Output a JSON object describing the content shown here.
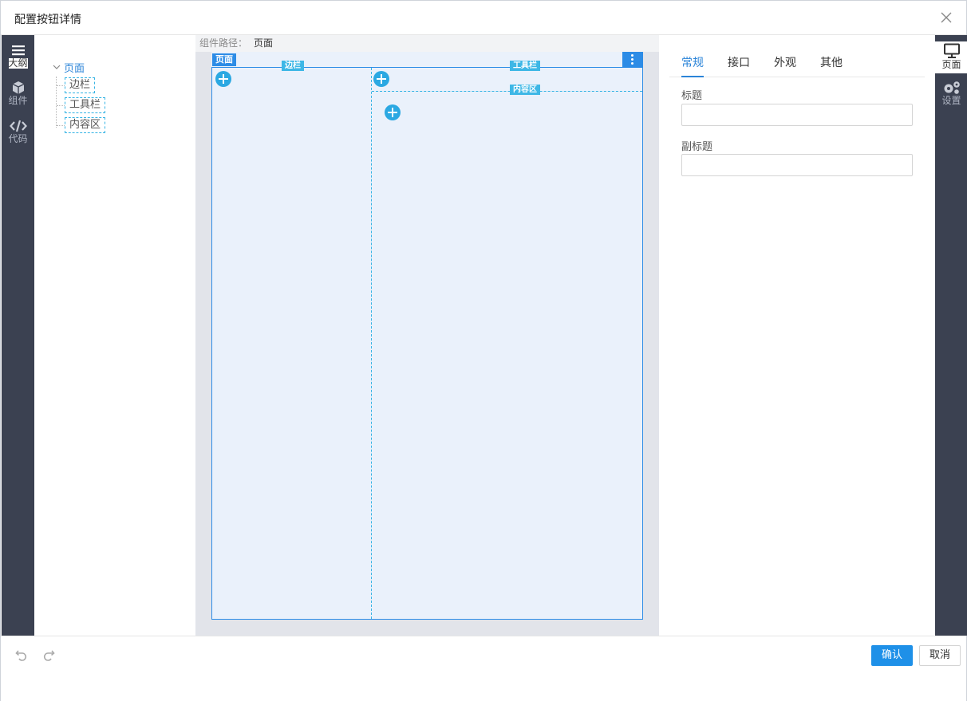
{
  "dialog": {
    "title": "配置按钮详情"
  },
  "left_sidebar": {
    "items": [
      {
        "label": "大纲",
        "icon": "menu-icon"
      },
      {
        "label": "组件",
        "icon": "cube-icon"
      },
      {
        "label": "代码",
        "icon": "code-icon"
      }
    ]
  },
  "outline": {
    "root": "页面",
    "children": [
      "边栏",
      "工具栏",
      "内容区"
    ]
  },
  "canvas": {
    "path_label": "组件路径：",
    "path_value": "页面",
    "page_tag": "页面",
    "sidebar_tag": "边栏",
    "toolbar_tag": "工具栏",
    "content_tag": "内容区"
  },
  "props": {
    "tabs": [
      "常规",
      "接口",
      "外观",
      "其他"
    ],
    "active_tab": 0,
    "title_label": "标题",
    "title_value": "",
    "subtitle_label": "副标题",
    "subtitle_value": ""
  },
  "right_sidebar": {
    "items": [
      {
        "label": "页面",
        "icon": "monitor-icon"
      },
      {
        "label": "设置",
        "icon": "gears-icon"
      }
    ]
  },
  "footer": {
    "confirm_label": "确认",
    "cancel_label": "取消"
  },
  "colors": {
    "accent": "#2b84d8",
    "sidebar_bg": "#3b4151",
    "region_border": "#34b3e4",
    "page_bg": "#eaf1fb"
  }
}
